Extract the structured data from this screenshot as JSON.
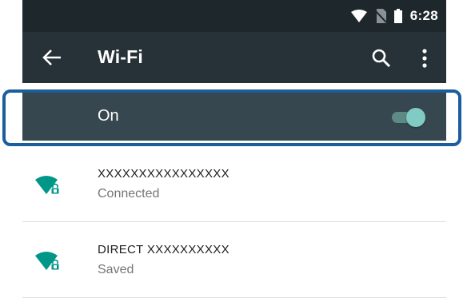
{
  "status_bar": {
    "time": "6:28",
    "icons": [
      "wifi-icon",
      "no-sim-icon",
      "battery-icon"
    ]
  },
  "toolbar": {
    "title": "Wi-Fi",
    "back_icon": "arrow-back-icon",
    "search_icon": "search-icon",
    "more_icon": "more-vert-icon"
  },
  "wifi_switch": {
    "label": "On",
    "state": "on"
  },
  "networks": [
    {
      "ssid": "XXXXXXXXXXXXXXXX",
      "status": "Connected",
      "icon": "wifi-lock-icon"
    },
    {
      "ssid": "DIRECT XXXXXXXXXX",
      "status": "Saved",
      "icon": "wifi-lock-icon"
    }
  ],
  "colors": {
    "status_bar": "#1e272c",
    "toolbar": "#263238",
    "switch_bar": "#37474f",
    "accent": "#80cbc4",
    "wifi_icon": "#009688",
    "highlight": "#1c5d9b"
  }
}
